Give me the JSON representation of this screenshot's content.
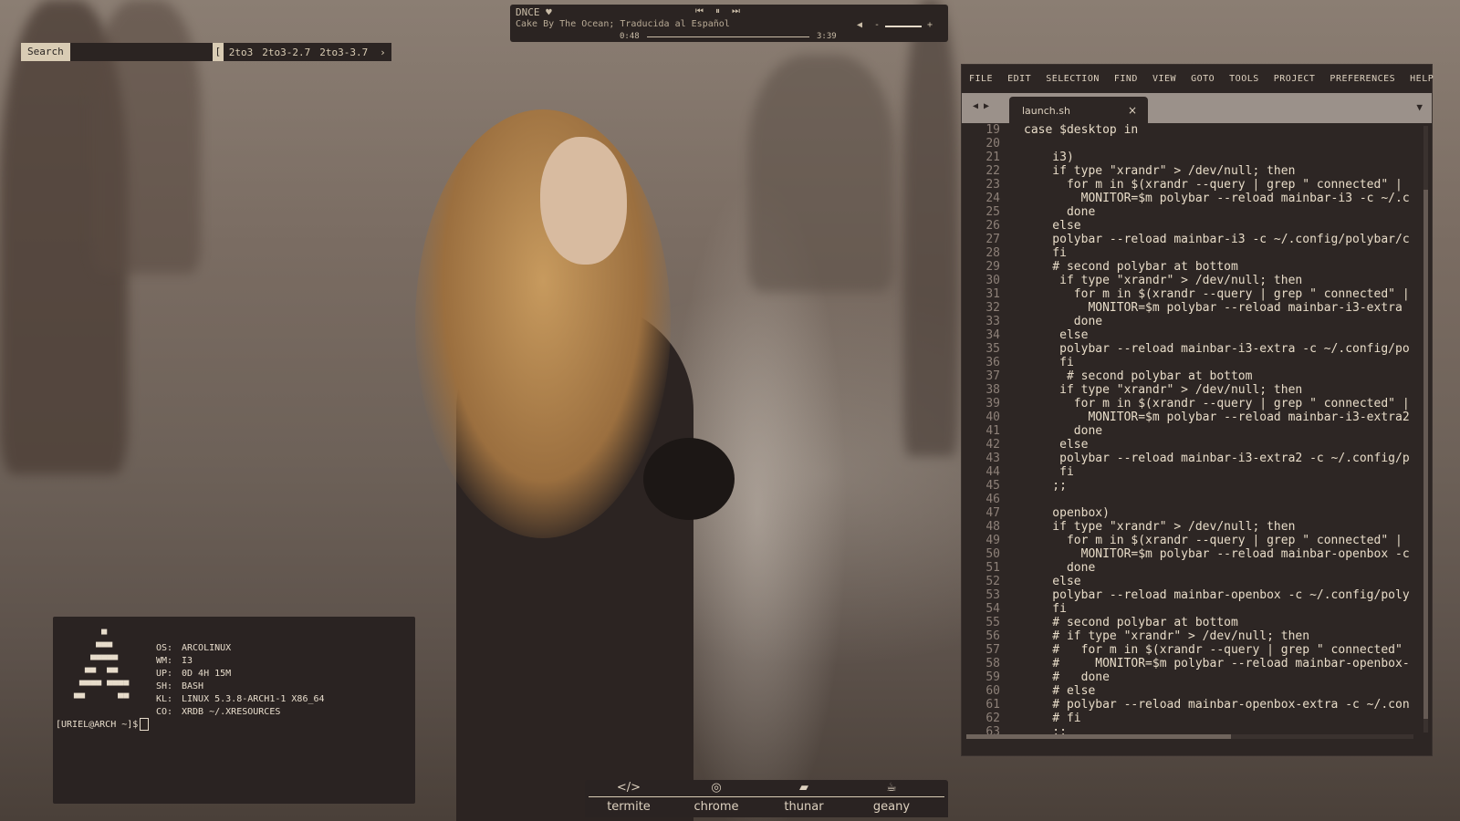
{
  "search": {
    "label": "Search",
    "value": "",
    "bracket": "[",
    "results": [
      "2to3",
      "2to3-2.7",
      "2to3-3.7"
    ],
    "next_icon": "chevron-right-icon"
  },
  "media": {
    "artist": "DNCE ♥",
    "song": "Cake By The Ocean; Traducida al Español",
    "elapsed": "0:48",
    "total": "3:39",
    "progress": 0.22,
    "prev_icon": "⏮",
    "play_icon": "⏸",
    "next_icon": "⏭",
    "volume_icon": "◀",
    "volume_minus": "-",
    "volume_plus": "+",
    "volume": 0.8
  },
  "editor": {
    "menu": [
      "FILE",
      "EDIT",
      "SELECTION",
      "FIND",
      "VIEW",
      "GOTO",
      "TOOLS",
      "PROJECT",
      "PREFERENCES",
      "HELP"
    ],
    "tab_nav": "◀ ▶",
    "tab_name": "launch.sh",
    "tab_close": "×",
    "tab_menu": "▼",
    "lines": [
      {
        "n": "19",
        "t": "case $desktop in"
      },
      {
        "n": "20",
        "t": ""
      },
      {
        "n": "21",
        "t": "    i3)"
      },
      {
        "n": "22",
        "t": "    if type \"xrandr\" > /dev/null; then"
      },
      {
        "n": "23",
        "t": "      for m in $(xrandr --query | grep \" connected\" |"
      },
      {
        "n": "24",
        "t": "        MONITOR=$m polybar --reload mainbar-i3 -c ~/.c"
      },
      {
        "n": "25",
        "t": "      done"
      },
      {
        "n": "26",
        "t": "    else"
      },
      {
        "n": "27",
        "t": "    polybar --reload mainbar-i3 -c ~/.config/polybar/c"
      },
      {
        "n": "28",
        "t": "    fi"
      },
      {
        "n": "29",
        "t": "    # second polybar at bottom"
      },
      {
        "n": "30",
        "t": "     if type \"xrandr\" > /dev/null; then"
      },
      {
        "n": "31",
        "t": "       for m in $(xrandr --query | grep \" connected\" |"
      },
      {
        "n": "32",
        "t": "         MONITOR=$m polybar --reload mainbar-i3-extra"
      },
      {
        "n": "33",
        "t": "       done"
      },
      {
        "n": "34",
        "t": "     else"
      },
      {
        "n": "35",
        "t": "     polybar --reload mainbar-i3-extra -c ~/.config/po"
      },
      {
        "n": "36",
        "t": "     fi"
      },
      {
        "n": "37",
        "t": "      # second polybar at bottom"
      },
      {
        "n": "38",
        "t": "     if type \"xrandr\" > /dev/null; then"
      },
      {
        "n": "39",
        "t": "       for m in $(xrandr --query | grep \" connected\" |"
      },
      {
        "n": "40",
        "t": "         MONITOR=$m polybar --reload mainbar-i3-extra2"
      },
      {
        "n": "41",
        "t": "       done"
      },
      {
        "n": "42",
        "t": "     else"
      },
      {
        "n": "43",
        "t": "     polybar --reload mainbar-i3-extra2 -c ~/.config/p"
      },
      {
        "n": "44",
        "t": "     fi"
      },
      {
        "n": "45",
        "t": "    ;;"
      },
      {
        "n": "46",
        "t": ""
      },
      {
        "n": "47",
        "t": "    openbox)"
      },
      {
        "n": "48",
        "t": "    if type \"xrandr\" > /dev/null; then"
      },
      {
        "n": "49",
        "t": "      for m in $(xrandr --query | grep \" connected\" |"
      },
      {
        "n": "50",
        "t": "        MONITOR=$m polybar --reload mainbar-openbox -c"
      },
      {
        "n": "51",
        "t": "      done"
      },
      {
        "n": "52",
        "t": "    else"
      },
      {
        "n": "53",
        "t": "    polybar --reload mainbar-openbox -c ~/.config/poly"
      },
      {
        "n": "54",
        "t": "    fi"
      },
      {
        "n": "55",
        "t": "    # second polybar at bottom"
      },
      {
        "n": "56",
        "t": "    # if type \"xrandr\" > /dev/null; then"
      },
      {
        "n": "57",
        "t": "    #   for m in $(xrandr --query | grep \" connected\""
      },
      {
        "n": "58",
        "t": "    #     MONITOR=$m polybar --reload mainbar-openbox-"
      },
      {
        "n": "59",
        "t": "    #   done"
      },
      {
        "n": "60",
        "t": "    # else"
      },
      {
        "n": "61",
        "t": "    # polybar --reload mainbar-openbox-extra -c ~/.con"
      },
      {
        "n": "62",
        "t": "    # fi"
      },
      {
        "n": "63",
        "t": "    ;;"
      }
    ]
  },
  "terminal": {
    "logo": "      ▀\n     ▀▀▀\n    ▀▀▀▀▀\n   ▀▀  ▀▀\n  ▀▀▀▀ ▀▀▀▀\n ▀▀      ▀▀",
    "info": [
      {
        "key": "OS:",
        "value": "ARCOLINUX"
      },
      {
        "key": "WM:",
        "value": "I3"
      },
      {
        "key": "UP:",
        "value": "0D 4H 15M"
      },
      {
        "key": "SH:",
        "value": "BASH"
      },
      {
        "key": "KL:",
        "value": "LINUX 5.3.8-ARCH1-1 X86_64"
      },
      {
        "key": "CO:",
        "value": "XRDB ~/.XRESOURCES"
      }
    ],
    "prompt": "[URIEL@ARCH ~]$"
  },
  "dock": {
    "items": [
      {
        "label": "termite",
        "icon": "</>",
        "icon_name": "code-icon"
      },
      {
        "label": "chrome",
        "icon": "◎",
        "icon_name": "chrome-icon"
      },
      {
        "label": "thunar",
        "icon": "▰",
        "icon_name": "folder-icon"
      },
      {
        "label": "geany",
        "icon": "☕",
        "icon_name": "cup-icon"
      }
    ]
  },
  "colors": {
    "panel": "#2b2422",
    "text": "#ddd1bf",
    "accent": "#d9ccb4"
  }
}
